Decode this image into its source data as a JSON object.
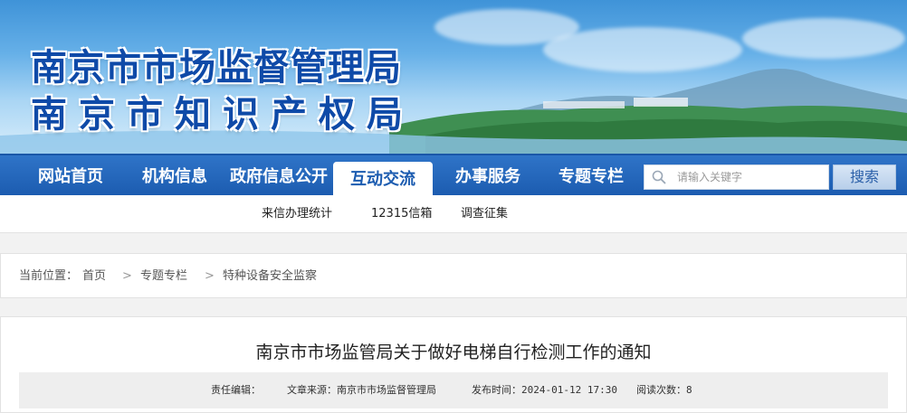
{
  "header": {
    "title_line1": "南京市市场监督管理局",
    "title_line2": "南京市知识产权局"
  },
  "nav": {
    "items": [
      {
        "label": "网站首页"
      },
      {
        "label": "机构信息"
      },
      {
        "label": "政府信息公开"
      },
      {
        "label": "互动交流",
        "active": true
      },
      {
        "label": "办事服务"
      },
      {
        "label": "专题专栏"
      }
    ],
    "search": {
      "placeholder": "请输入关键字",
      "button_label": "搜索",
      "icon": "search-icon"
    }
  },
  "subnav": {
    "items": [
      {
        "label": "来信办理统计"
      },
      {
        "label": "12315信箱"
      },
      {
        "label": "调查征集"
      }
    ]
  },
  "breadcrumb": {
    "prefix": "当前位置：",
    "items": [
      "首页",
      "专题专栏",
      "特种设备安全监察"
    ],
    "separator": ">"
  },
  "article": {
    "title": "南京市市场监管局关于做好电梯自行检测工作的通知",
    "meta": {
      "editor": "责任编辑：",
      "source": "文章来源：南京市市场监督管理局",
      "published": "发布时间：2024-01-12 17:30",
      "views": "阅读次数：8"
    }
  },
  "colors": {
    "nav_blue": "#1c5cb0",
    "title_blue": "#0e4aa8"
  }
}
